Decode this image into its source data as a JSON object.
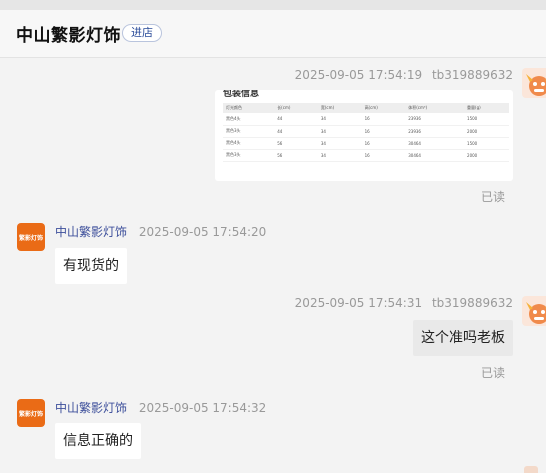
{
  "header": {
    "shop_name": "中山繁影灯饰",
    "enter_label": "进店"
  },
  "messages": [
    {
      "type": "image",
      "sender": "tb319889632",
      "time": "2025-09-05 17:54:19",
      "read_label": "已读",
      "image": {
        "title": "包装信息",
        "columns": [
          "灯光颜色",
          "长(cm)",
          "宽(cm)",
          "高(cm)",
          "体积(cm³)",
          "重量(g)"
        ],
        "rows": [
          [
            "黑色4头",
            "44",
            "34",
            "16",
            "23936",
            "1500"
          ],
          [
            "黑色3头",
            "44",
            "34",
            "16",
            "23936",
            "2000"
          ],
          [
            "黑色4头",
            "56",
            "34",
            "16",
            "30464",
            "1500"
          ],
          [
            "黑色3头",
            "56",
            "34",
            "16",
            "30464",
            "2000"
          ]
        ]
      }
    },
    {
      "type": "text",
      "sender": "中山繁影灯饰",
      "time": "2025-09-05 17:54:20",
      "text": "有现货的"
    },
    {
      "type": "text",
      "sender": "tb319889632",
      "time": "2025-09-05 17:54:31",
      "text": "这个准吗老板",
      "read_label": "已读"
    },
    {
      "type": "text",
      "sender": "中山繁影灯饰",
      "time": "2025-09-05 17:54:32",
      "text": "信息正确的"
    }
  ],
  "shop_avatar_text": "繁影灯饰",
  "colors": {
    "shop_avatar": "#ea6b16",
    "sender_name": "#3d4f9b",
    "enter_button_text": "#2b4c9a"
  }
}
